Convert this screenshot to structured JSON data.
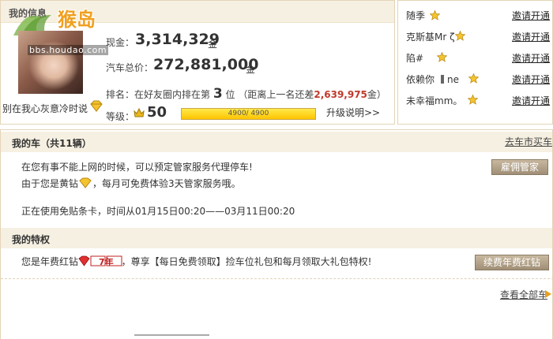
{
  "info": {
    "title": "我的信息",
    "watermark_text": "猴岛",
    "avatar_url_text": "bbs.houdao.com",
    "mood": "别在我心灰意冷时说",
    "cash_label": "现金：",
    "cash_value": "3,314,329",
    "cash_unit": "金",
    "car_total_label": "汽车总价：",
    "car_total_value": "272,881,000",
    "car_total_unit": "金",
    "rank_prefix": "排名：在好友圈内排在第",
    "rank_value": "3",
    "rank_middle": "位 （距离上一名还差",
    "rank_gap": "2,639,975",
    "rank_suffix": "金）",
    "level_label": "等级：",
    "level_value": "50",
    "xp_text": "4900/ 4900",
    "xp_fraction": 1.0,
    "upgrade_link": "升级说明>>"
  },
  "friends": [
    {
      "name": "随季",
      "invite": "邀请开通"
    },
    {
      "name": "克斯基Mr ζ",
      "invite": "邀请开通"
    },
    {
      "name": "陷#",
      "invite": "邀请开通"
    },
    {
      "name": "依赖你",
      "suffix": "ne",
      "invite": "邀请开通"
    },
    {
      "name": "未幸福mm。",
      "invite": "邀请开通"
    }
  ],
  "cars": {
    "title": "我的车（共11辆）",
    "buy_link": "去车市买车",
    "line1": "在您有事不能上网的时候，可以预定管家服务代理停车!",
    "line2_prefix": "由于您是黄钻",
    "line2_suffix": "，每月可免费体验3天管家服务哦。",
    "hire_button": "雇佣管家",
    "line3": "正在使用免贴条卡，时间从01月15日00:20——03月11日00:20"
  },
  "privilege": {
    "title": "我的特权",
    "line_prefix": "您是年费红钻",
    "badge_text": "7年",
    "line_suffix": "，尊享【每日免费领取】捡车位礼包和每月领取大礼包特权!",
    "renew_button": "续费年费红钻",
    "all_cars_link": "查看全部车"
  },
  "colors": {
    "section_bg": "#f6f0e2",
    "border": "#e3d4b8",
    "gap_red": "#c0392b",
    "button_bg": "#a08f76",
    "xp_fill": "#ffd400"
  }
}
